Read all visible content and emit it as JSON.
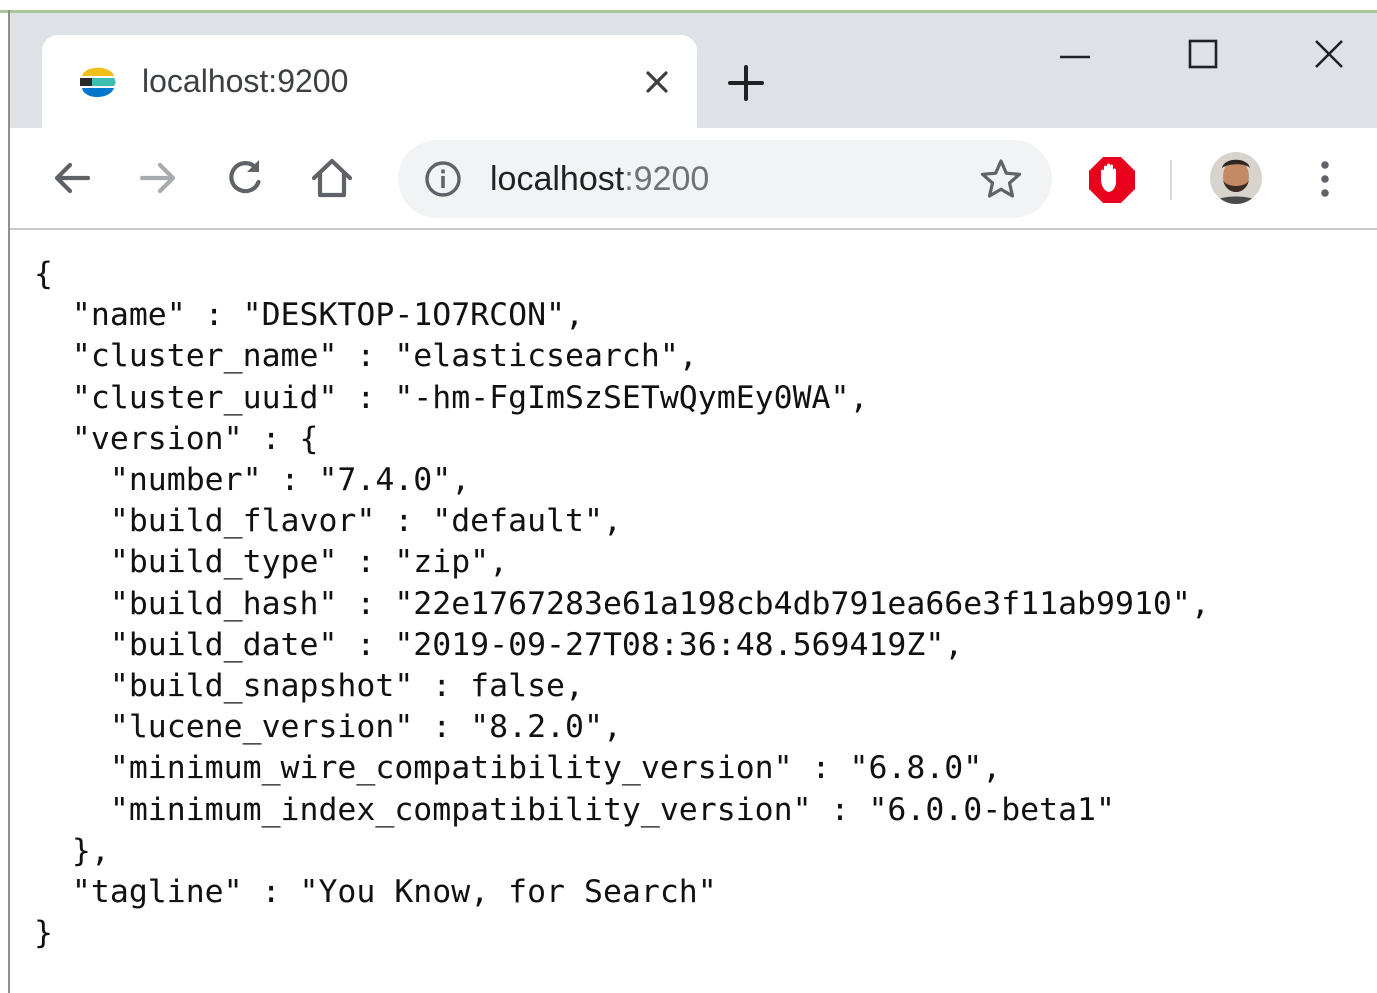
{
  "browser": {
    "tab": {
      "title": "localhost:9200",
      "favicon": "elastic-logo-icon"
    },
    "window_controls": [
      "minimize-icon",
      "maximize-icon",
      "close-icon"
    ],
    "toolbar": {
      "icons": [
        "back-arrow-icon",
        "forward-arrow-icon",
        "reload-icon",
        "home-icon",
        "info-icon",
        "star-icon",
        "adblock-stop-icon",
        "avatar",
        "kebab-menu-icon"
      ]
    },
    "omnibox": {
      "host": "localhost",
      "port": ":9200"
    }
  },
  "content": {
    "json_text": "{\n  \"name\" : \"DESKTOP-1O7RCON\",\n  \"cluster_name\" : \"elasticsearch\",\n  \"cluster_uuid\" : \"-hm-FgImSzSETwQymEy0WA\",\n  \"version\" : {\n    \"number\" : \"7.4.0\",\n    \"build_flavor\" : \"default\",\n    \"build_type\" : \"zip\",\n    \"build_hash\" : \"22e1767283e61a198cb4db791ea66e3f11ab9910\",\n    \"build_date\" : \"2019-09-27T08:36:48.569419Z\",\n    \"build_snapshot\" : false,\n    \"lucene_version\" : \"8.2.0\",\n    \"minimum_wire_compatibility_version\" : \"6.8.0\",\n    \"minimum_index_compatibility_version\" : \"6.0.0-beta1\"\n  },\n  \"tagline\" : \"You Know, for Search\"\n}"
  },
  "colors": {
    "tab_strip": "#dee1e6",
    "omnibox": "#f1f3f4",
    "icon": "#5f6368",
    "adblock": "#e8001c"
  }
}
